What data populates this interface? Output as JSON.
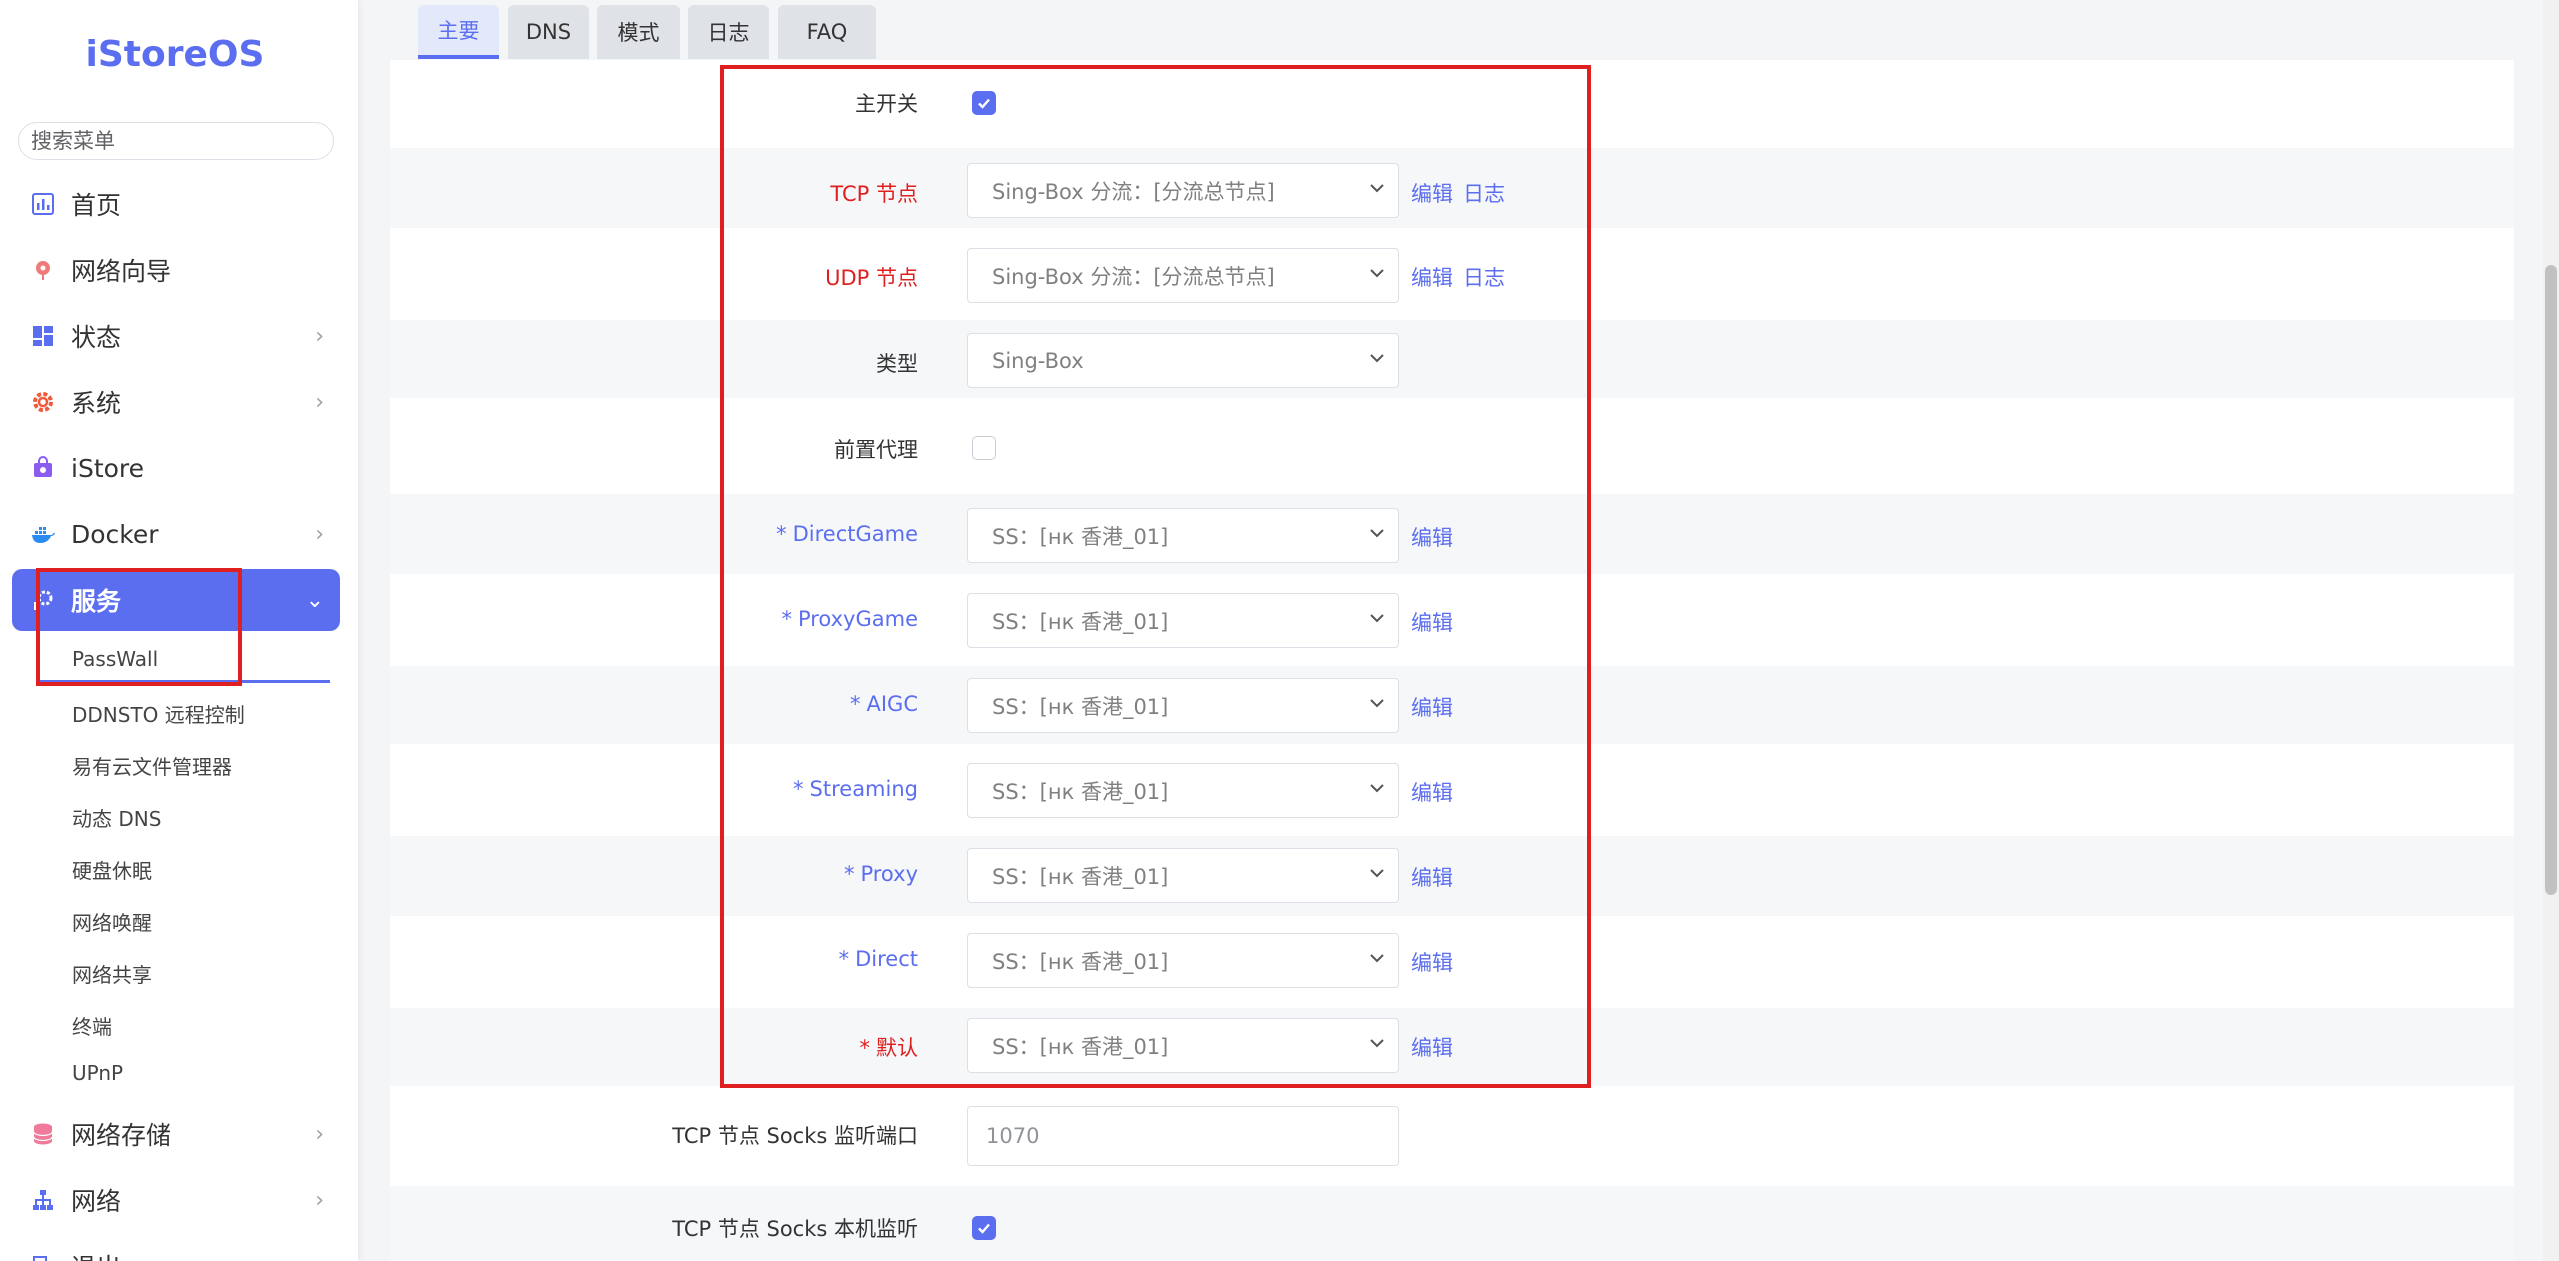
{
  "brand": "iStoreOS",
  "search_placeholder": "搜索菜单",
  "nav": {
    "home": "首页",
    "wizard": "网络向导",
    "status": "状态",
    "system": "系统",
    "istore": "iStore",
    "docker": "Docker",
    "services": "服务",
    "storage": "网络存储",
    "network": "网络",
    "logout": "退出"
  },
  "services_sub": [
    "PassWall",
    "DDNSTO 远程控制",
    "易有云文件管理器",
    "动态 DNS",
    "硬盘休眠",
    "网络唤醒",
    "网络共享",
    "终端",
    "UPnP"
  ],
  "tabs": [
    "主要",
    "DNS",
    "模式",
    "日志",
    "FAQ"
  ],
  "form": {
    "master_switch": "主开关",
    "tcp_node": {
      "label": "TCP 节点",
      "value": "Sing-Box 分流：[分流总节点]"
    },
    "udp_node": {
      "label": "UDP 节点",
      "value": "Sing-Box 分流：[分流总节点]"
    },
    "type": {
      "label": "类型",
      "value": "Sing-Box"
    },
    "preproxy": "前置代理",
    "groups": [
      {
        "label": "DirectGame",
        "value": "SS：[нк 香港_01]"
      },
      {
        "label": "ProxyGame",
        "value": "SS：[нк 香港_01]"
      },
      {
        "label": "AIGC",
        "value": "SS：[нк 香港_01]"
      },
      {
        "label": "Streaming",
        "value": "SS：[нк 香港_01]"
      },
      {
        "label": "Proxy",
        "value": "SS：[нк 香港_01]"
      },
      {
        "label": "Direct",
        "value": "SS：[нк 香港_01]"
      }
    ],
    "default": {
      "label": "默认",
      "value": "SS：[нк 香港_01]"
    },
    "socks_port": {
      "label": "TCP 节点 Socks 监听端口",
      "placeholder": "1070"
    },
    "socks_local": "TCP 节点 Socks 本机监听",
    "edit": "编辑",
    "log": "日志",
    "required_mark": "*"
  },
  "colors": {
    "accent": "#5b6ef0",
    "required_red": "#e02020",
    "highlight_box": "#e02020"
  }
}
